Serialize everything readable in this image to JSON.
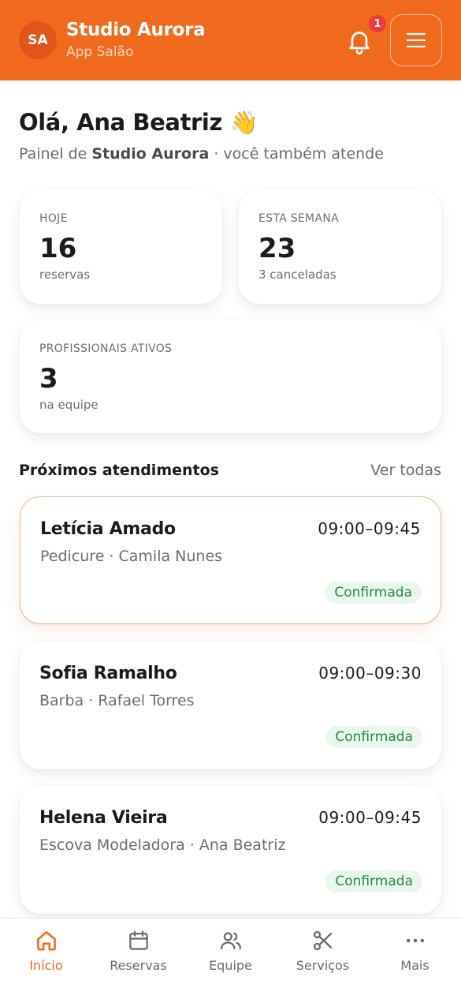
{
  "header": {
    "avatar_initials": "SA",
    "title": "Studio Aurora",
    "subtitle": "App Salão",
    "notification_count": "1",
    "accent_color": "#F06A1E"
  },
  "greeting": {
    "text": "Olá, Ana Beatriz 👋",
    "subtitle_prefix": "Painel de ",
    "subtitle_business": "Studio Aurora",
    "subtitle_suffix": " · você também atende"
  },
  "stats": [
    {
      "label": "HOJE",
      "value": "16",
      "note": "reservas"
    },
    {
      "label": "ESTA SEMANA",
      "value": "23",
      "note": "3 canceladas"
    },
    {
      "label": "PROFISSIONAIS ATIVOS",
      "value": "3",
      "note": "na equipe"
    }
  ],
  "upcoming": {
    "title": "Próximos atendimentos",
    "view_all": "Ver todas",
    "items": [
      {
        "client": "Letícia Amado",
        "time": "09:00–09:45",
        "detail": "Pedicure · Camila Nunes",
        "status": "Confirmada"
      },
      {
        "client": "Sofia Ramalho",
        "time": "09:00–09:30",
        "detail": "Barba · Rafael Torres",
        "status": "Confirmada"
      },
      {
        "client": "Helena Vieira",
        "time": "09:00–09:45",
        "detail": "Escova Modeladora · Ana Beatriz",
        "status": "Confirmada"
      }
    ]
  },
  "bottom_nav": [
    {
      "label": "Início",
      "icon": "home-icon",
      "active": true
    },
    {
      "label": "Reservas",
      "icon": "calendar-icon",
      "active": false
    },
    {
      "label": "Equipe",
      "icon": "users-icon",
      "active": false
    },
    {
      "label": "Serviços",
      "icon": "scissors-icon",
      "active": false
    },
    {
      "label": "Mais",
      "icon": "more-icon",
      "active": false
    }
  ]
}
